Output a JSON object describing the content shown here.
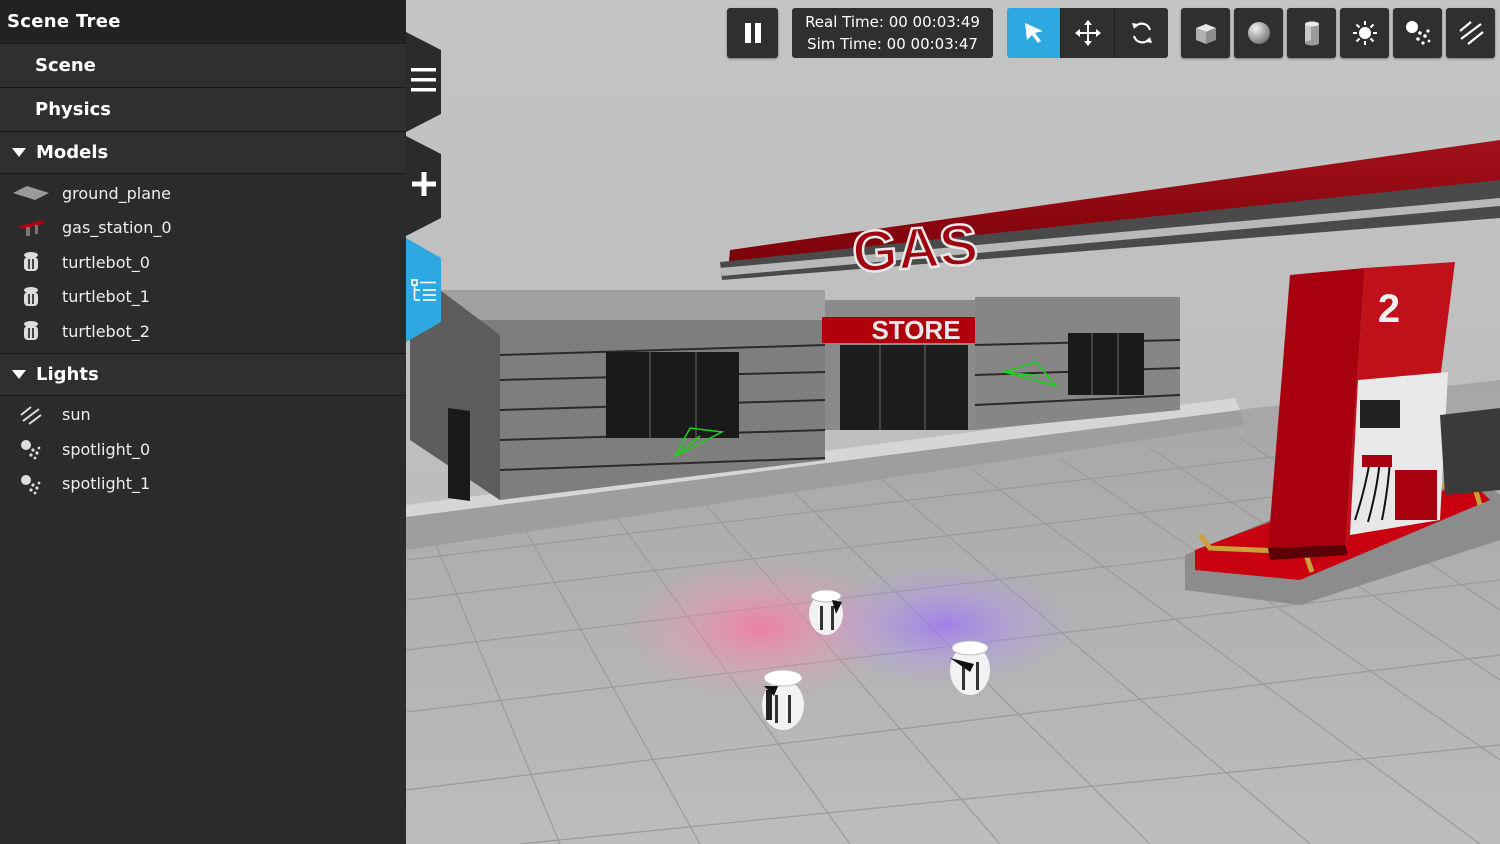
{
  "panel": {
    "title": "Scene Tree",
    "rows": [
      {
        "label": "Scene"
      },
      {
        "label": "Physics"
      }
    ],
    "models": {
      "label": "Models",
      "items": [
        {
          "label": "ground_plane",
          "icon": "plane-icon"
        },
        {
          "label": "gas_station_0",
          "icon": "gas-station-icon"
        },
        {
          "label": "turtlebot_0",
          "icon": "robot-icon"
        },
        {
          "label": "turtlebot_1",
          "icon": "robot-icon"
        },
        {
          "label": "turtlebot_2",
          "icon": "robot-icon"
        }
      ]
    },
    "lights": {
      "label": "Lights",
      "items": [
        {
          "label": "sun",
          "icon": "directional-light-icon"
        },
        {
          "label": "spotlight_0",
          "icon": "spotlight-icon"
        },
        {
          "label": "spotlight_1",
          "icon": "spotlight-icon"
        }
      ]
    }
  },
  "time": {
    "real": "Real Time: 00 00:03:49",
    "sim": "Sim Time: 00 00:03:47"
  },
  "toolbar": {
    "modes": [
      "select-mode",
      "translate-mode",
      "rotate-mode"
    ],
    "active_mode": "select-mode",
    "inserts": [
      "box-icon",
      "sphere-icon",
      "cylinder-icon",
      "point-light-icon",
      "spotlight-icon",
      "directional-light-icon"
    ]
  },
  "scene": {
    "canopy_sign": "GAS",
    "store_sign": "STORE",
    "pump_number": "2"
  },
  "colors": {
    "panel_bg": "#2b2b2b",
    "accent": "#2ea8e0",
    "canopy_red": "#8b0000"
  }
}
